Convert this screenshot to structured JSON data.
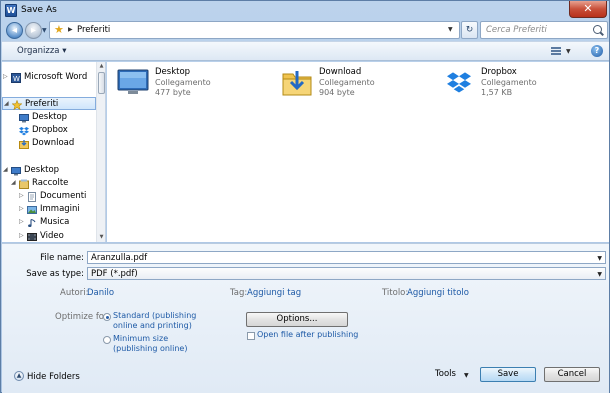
{
  "window": {
    "title": "Save As",
    "close_glyph": "✕"
  },
  "address": {
    "location": "Preferiti",
    "search_placeholder": "Cerca Preferiti"
  },
  "toolbar": {
    "organize_label": "Organizza ▾",
    "help_glyph": "?"
  },
  "nav": {
    "items": [
      {
        "label": "Microsoft Word",
        "icon": "word-icon",
        "indent": 0
      },
      {
        "label": "Preferiti",
        "icon": "star-icon",
        "indent": 0,
        "selected": true
      },
      {
        "label": "Desktop",
        "icon": "desktop-icon",
        "indent": 1
      },
      {
        "label": "Dropbox",
        "icon": "dropbox-icon",
        "indent": 1
      },
      {
        "label": "Download",
        "icon": "download-icon",
        "indent": 1
      },
      {
        "label": "Desktop",
        "icon": "desktop-icon",
        "indent": 0
      },
      {
        "label": "Raccolte",
        "icon": "libraries-icon",
        "indent": 1
      },
      {
        "label": "Documenti",
        "icon": "documents-icon",
        "indent": 2
      },
      {
        "label": "Immagini",
        "icon": "pictures-icon",
        "indent": 2
      },
      {
        "label": "Musica",
        "icon": "music-icon",
        "indent": 2
      },
      {
        "label": "Video",
        "icon": "video-icon",
        "indent": 2
      }
    ]
  },
  "files": [
    {
      "name": "Desktop",
      "type": "Collegamento",
      "size": "477 byte",
      "icon": "desktop-shortcut-icon"
    },
    {
      "name": "Download",
      "type": "Collegamento",
      "size": "904 byte",
      "icon": "download-folder-icon"
    },
    {
      "name": "Dropbox",
      "type": "Collegamento",
      "size": "1,57 KB",
      "icon": "dropbox-icon"
    }
  ],
  "form": {
    "file_name_label": "File name:",
    "file_name_value": "Aranzulla.pdf",
    "save_type_label": "Save as type:",
    "save_type_value": "PDF (*.pdf)",
    "authors_label": "Autori:",
    "authors_value": "Danilo",
    "tags_label": "Tag:",
    "tags_value": "Aggiungi tag",
    "title_label": "Titolo:",
    "title_value": "Aggiungi titolo",
    "optimize_label": "Optimize for:",
    "opt_standard": "Standard (publishing online and printing)",
    "opt_minimum": "Minimum size (publishing online)",
    "options_button": "Options...",
    "open_after_label": "Open file after publishing"
  },
  "footer": {
    "hide_folders": "Hide Folders",
    "tools_label": "Tools",
    "save_button": "Save",
    "cancel_button": "Cancel"
  }
}
